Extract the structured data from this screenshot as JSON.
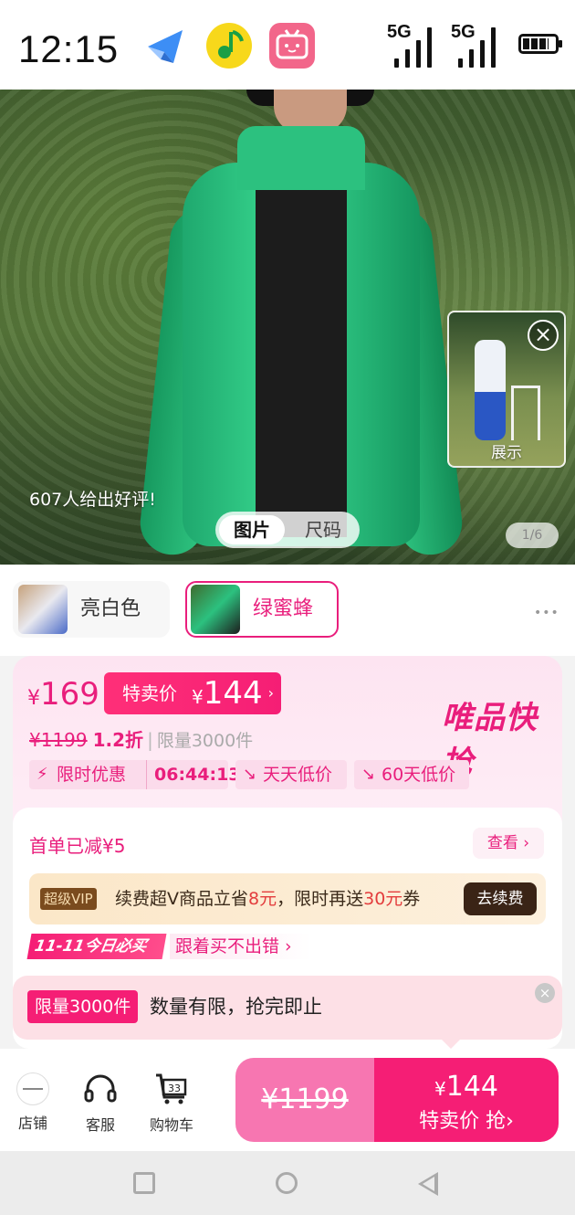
{
  "status_bar": {
    "time": "12:15",
    "apps": [
      "paper-plane-app-icon",
      "music-app-icon",
      "tv-app-icon"
    ],
    "network": [
      "5G",
      "5G"
    ],
    "battery_icon": "battery-icon"
  },
  "hero": {
    "review_note": "607人给出好评!",
    "media_tabs": {
      "photo": "图片",
      "size": "尺码"
    },
    "image_counter": "1/6",
    "float_video_label": "展示",
    "float_close": "×"
  },
  "colors": [
    {
      "name": "亮白色",
      "selected": false
    },
    {
      "name": "绿蜜蜂",
      "selected": true
    }
  ],
  "more_dots": "•••",
  "price": {
    "currency": "¥",
    "current": "169",
    "special_label": "特卖价",
    "special_value": "144",
    "chevron": "›",
    "original": "¥1199",
    "discount": "1.2折",
    "separator": "|",
    "limit": "限量3000件",
    "brand_tag": "唯品快抢"
  },
  "promo_tags": {
    "flash": {
      "label": "限时优惠",
      "timer": "06:44:13"
    },
    "daily_low": "天天低价",
    "sixty_low": "60天低价"
  },
  "coupon": {
    "first_order": "首单已减¥5",
    "view_label": "查看 ›"
  },
  "vip": {
    "badge": "超级VIP",
    "text_a": "续费超V商品立省",
    "amount_a": "8元",
    "text_b": "，限时再送",
    "amount_b": "30元",
    "text_c": "券",
    "renew_label": "去续费"
  },
  "double11": {
    "badge": "11-11今日必买",
    "text": "跟着买不出错 ›"
  },
  "limit_popup": {
    "badge": "限量3000件",
    "text": "数量有限，抢完即止",
    "close": "×"
  },
  "bottom_bar": {
    "store": "店铺",
    "service": "客服",
    "cart": "购物车",
    "cart_count": "33",
    "buy_original": "¥1199",
    "buy_currency": "¥",
    "buy_price": "144",
    "buy_label": "特卖价 抢›"
  },
  "accent_colors": {
    "brand_pink": "#e91e7c",
    "button_pink": "#f51e75",
    "vip_brown": "#3a2416"
  }
}
